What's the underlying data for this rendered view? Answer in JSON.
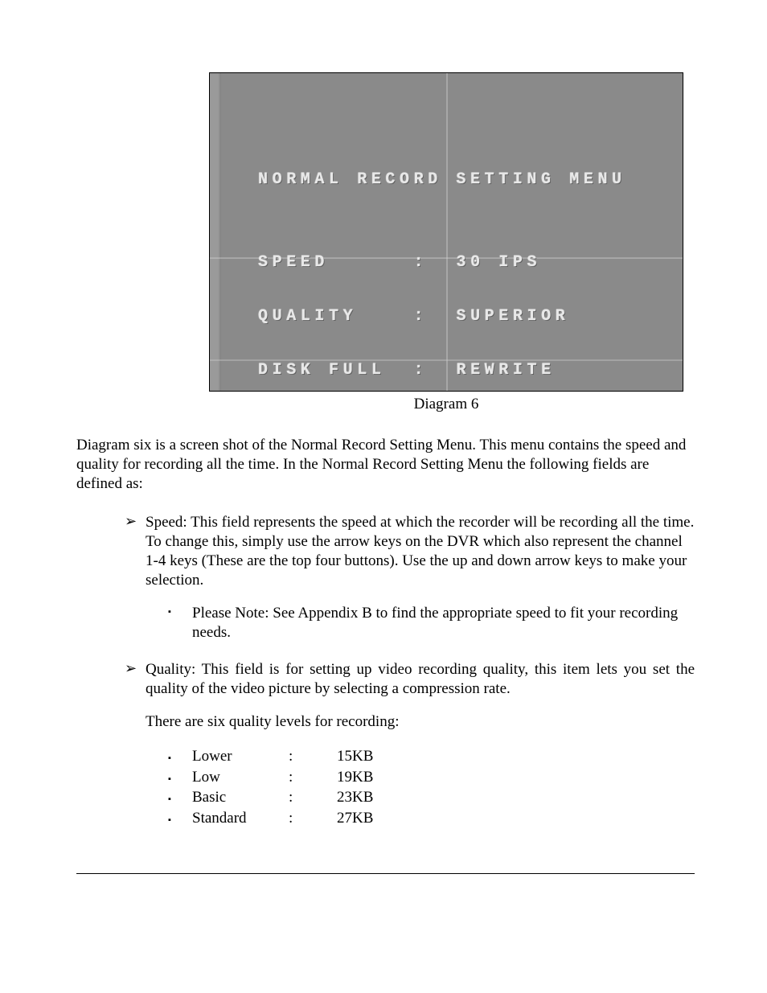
{
  "screenshot": {
    "title": "NORMAL RECORD SETTING MENU",
    "rows": [
      {
        "label": "SPEED",
        "sep": ":",
        "value": "30 IPS"
      },
      {
        "label": "QUALITY",
        "sep": ":",
        "value": "SUPERIOR"
      },
      {
        "label": "DISK FULL",
        "sep": ":",
        "value": "REWRITE"
      }
    ]
  },
  "caption": "Diagram 6",
  "body_intro": "Diagram six is a screen shot of the Normal Record Setting Menu. This menu contains the speed and quality for recording all the time. In the Normal Record Setting Menu the following fields are defined as:",
  "items": {
    "speed": "Speed: This field represents the speed at which the recorder will be recording all the time. To change this, simply use the arrow keys on the DVR which also represent the channel 1-4 keys (These are the top four buttons). Use the up and down arrow keys to make your selection.",
    "speed_note": "Please Note: See Appendix B to find the appropriate speed to fit your recording needs.",
    "quality": "Quality: This field is for setting up video recording quality, this item lets you set the quality of the video picture by selecting a compression rate.",
    "quality_levels_intro": "There are six quality levels for recording:",
    "quality_levels": [
      {
        "name": "Lower",
        "sep": ":",
        "size": "15KB"
      },
      {
        "name": "Low",
        "sep": ":",
        "size": "19KB"
      },
      {
        "name": "Basic",
        "sep": ":",
        "size": "23KB"
      },
      {
        "name": "Standard",
        "sep": ":",
        "size": "27KB"
      }
    ]
  },
  "bullets": {
    "arrow": "➢",
    "square": "▪"
  }
}
